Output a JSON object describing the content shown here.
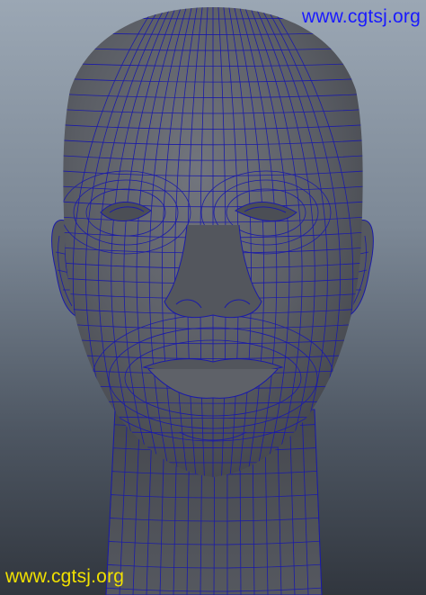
{
  "viewport": {
    "background_top": "#9ba7b4",
    "background_bottom": "#31363e",
    "model_shade": "#5c5f66",
    "wireframe_color": "#1b1ba8",
    "subject": "wireframe-head-model"
  },
  "watermarks": {
    "top_right": "www.cgtsj.org",
    "bottom_left": "www.cgtsj.org",
    "top_color": "#1a1aff",
    "bottom_color": "#f0e000"
  }
}
